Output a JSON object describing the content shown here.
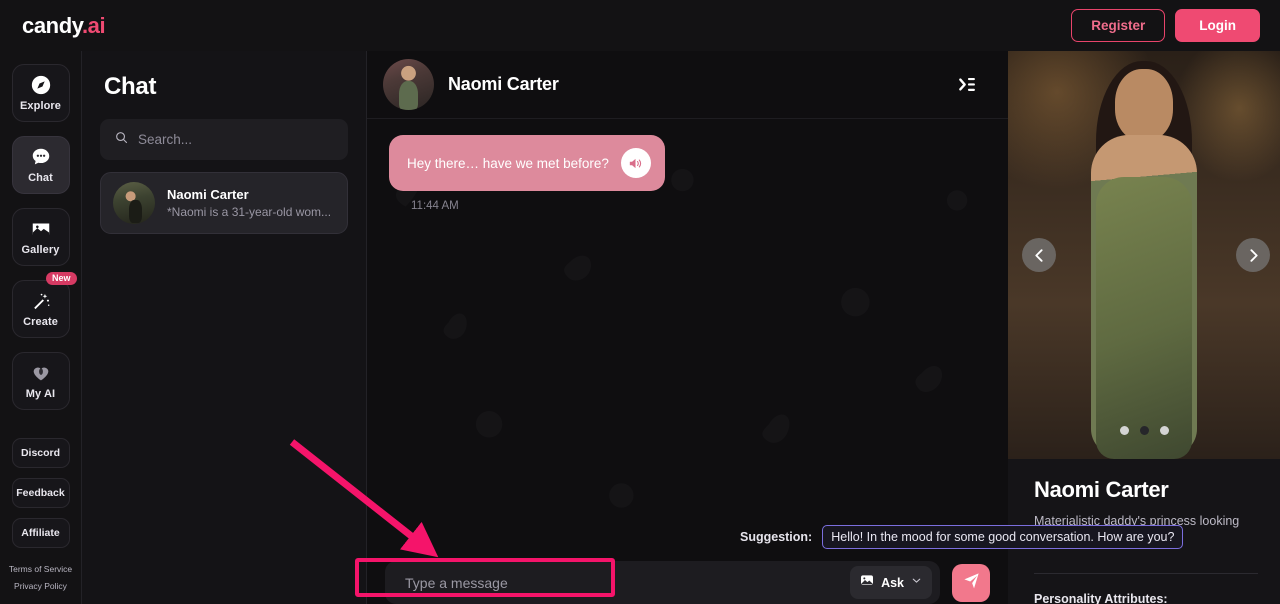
{
  "topbar": {
    "logo_main": "candy",
    "logo_accent": ".ai",
    "register_label": "Register",
    "login_label": "Login"
  },
  "sidebar": {
    "items": [
      {
        "label": "Explore",
        "icon": "compass-icon",
        "active": false
      },
      {
        "label": "Chat",
        "icon": "chat-bubble-icon",
        "active": true
      },
      {
        "label": "Gallery",
        "icon": "image-icon",
        "active": false
      },
      {
        "label": "Create",
        "icon": "magic-wand-icon",
        "active": false,
        "badge": "New"
      },
      {
        "label": "My AI",
        "icon": "heart-person-icon",
        "active": false
      }
    ],
    "links": [
      "Discord",
      "Feedback",
      "Affiliate"
    ],
    "legal": [
      "Terms of Service",
      "Privacy Policy"
    ]
  },
  "chat_list": {
    "title": "Chat",
    "search_placeholder": "Search...",
    "conversations": [
      {
        "name": "Naomi Carter",
        "preview": "*Naomi is a 31-year-old wom..."
      }
    ]
  },
  "conversation": {
    "header_name": "Naomi Carter",
    "messages": [
      {
        "text": "Hey there… have we met before?",
        "time": "11:44 AM",
        "from": "assistant",
        "has_audio": true
      }
    ]
  },
  "composer": {
    "suggestion_label": "Suggestion:",
    "suggestion_text": "Hello! In the mood for some good conversation. How are you?",
    "input_placeholder": "Type a message",
    "input_value": "",
    "ask_label": "Ask",
    "send_icon": "send-paper-plane-icon"
  },
  "character_panel": {
    "name": "Naomi Carter",
    "description": "Materialistic daddy's princess looking meeting new people",
    "section_title": "Personality Attributes:",
    "carousel": {
      "slide_count": 3,
      "active_index": 1
    }
  },
  "colors": {
    "accent_pink": "#ef4a72",
    "bubble_pink": "#dd8a9c",
    "send_pink": "#f2788c",
    "suggestion_border": "#7b6ede",
    "annotation": "#f5146a"
  }
}
